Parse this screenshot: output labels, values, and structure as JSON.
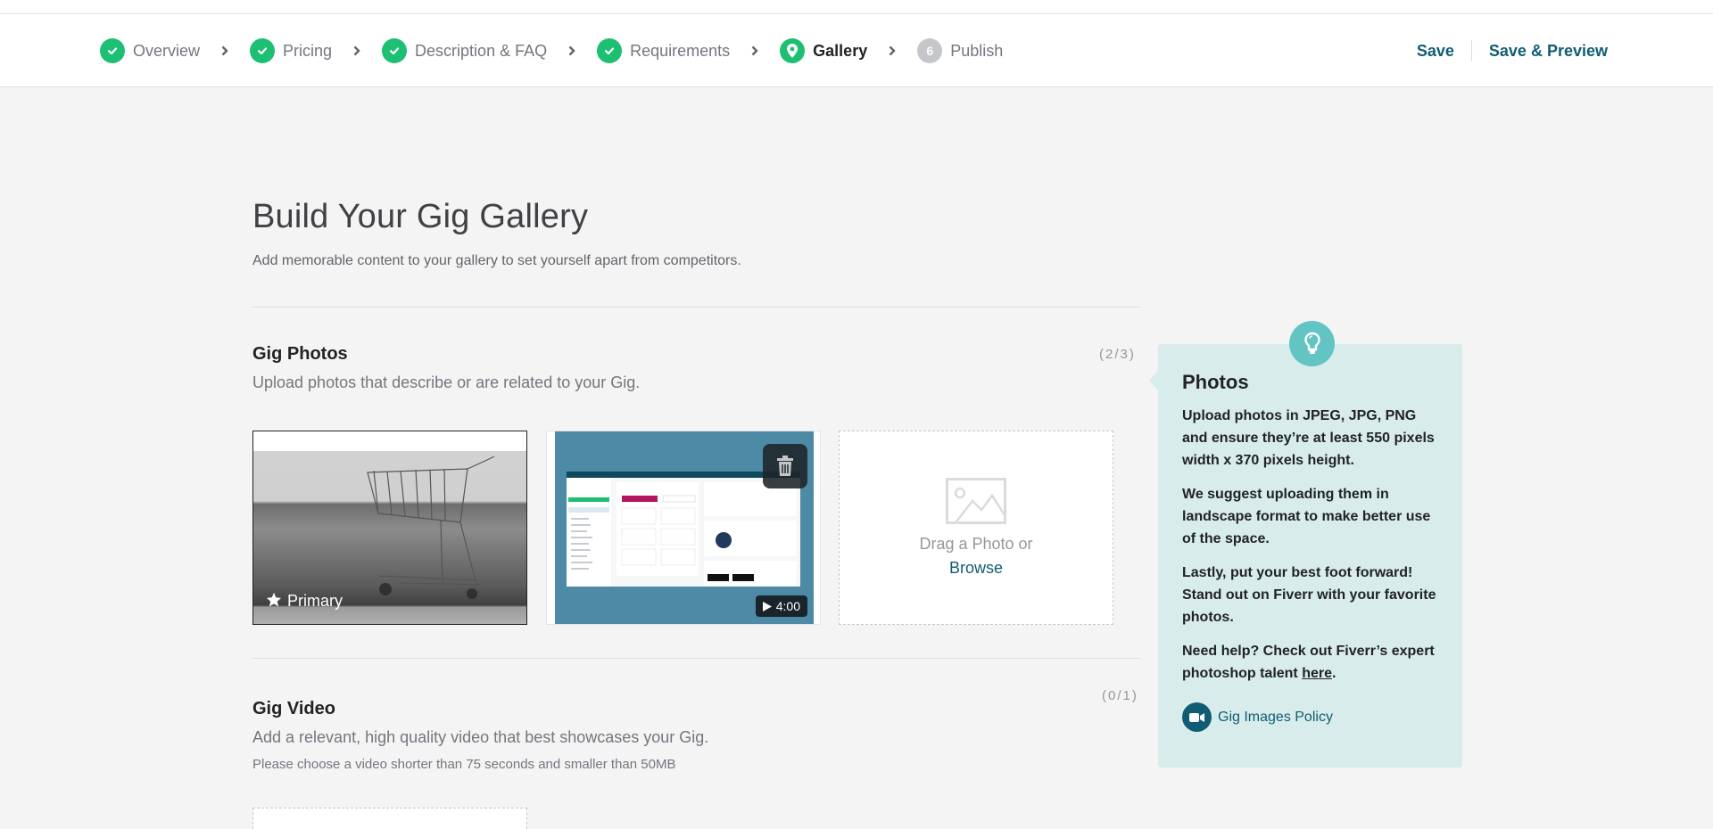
{
  "header": {
    "steps": [
      {
        "label": "Overview",
        "status": "complete",
        "icon": "check-icon"
      },
      {
        "label": "Pricing",
        "status": "complete",
        "icon": "check-icon"
      },
      {
        "label": "Description & FAQ",
        "status": "complete",
        "icon": "check-icon"
      },
      {
        "label": "Requirements",
        "status": "complete",
        "icon": "check-icon"
      },
      {
        "label": "Gallery",
        "status": "current",
        "icon": "location-pin-icon"
      },
      {
        "label": "Publish",
        "status": "pending",
        "number": "6"
      }
    ],
    "save_label": "Save",
    "save_preview_label": "Save & Preview"
  },
  "page": {
    "title": "Build Your Gig Gallery",
    "subtitle": "Add memorable content to your gallery to set yourself apart from competitors."
  },
  "photos": {
    "title": "Gig Photos",
    "description": "Upload photos that describe or are related to your Gig.",
    "counter": "(2/3)",
    "items": [
      {
        "type": "image",
        "subject": "shopping cart",
        "badge": "Primary",
        "badge_icon": "star-icon"
      },
      {
        "type": "video",
        "subject": "dashboard screen recording",
        "duration": "4:00",
        "delete_icon": "trash-icon"
      }
    ],
    "dropzone": {
      "text": "Drag a Photo or",
      "browse_label": "Browse"
    }
  },
  "video": {
    "title": "Gig Video",
    "description": "Add a relevant, high quality video that best showcases your Gig.",
    "note": "Please choose a video shorter than 75 seconds and smaller than 50MB",
    "counter": "(0/1)"
  },
  "tip": {
    "title": "Photos",
    "paragraphs": [
      "Upload photos in JPEG, JPG, PNG and ensure they’re at least 550 pixels width x 370 pixels height.",
      "We suggest uploading them in landscape format to make better use of the space.",
      "Lastly, put your best foot forward! Stand out on Fiverr with your favorite photos."
    ],
    "help_text": "Need help? Check out Fiverr’s expert photoshop talent ",
    "help_link": "here",
    "help_end": ".",
    "policy_link": "Gig Images Policy"
  },
  "colors": {
    "accent_green": "#1dbf73",
    "link_teal": "#105d73",
    "tip_bg": "#d8ecec",
    "tip_bulb": "#62c4c3"
  }
}
